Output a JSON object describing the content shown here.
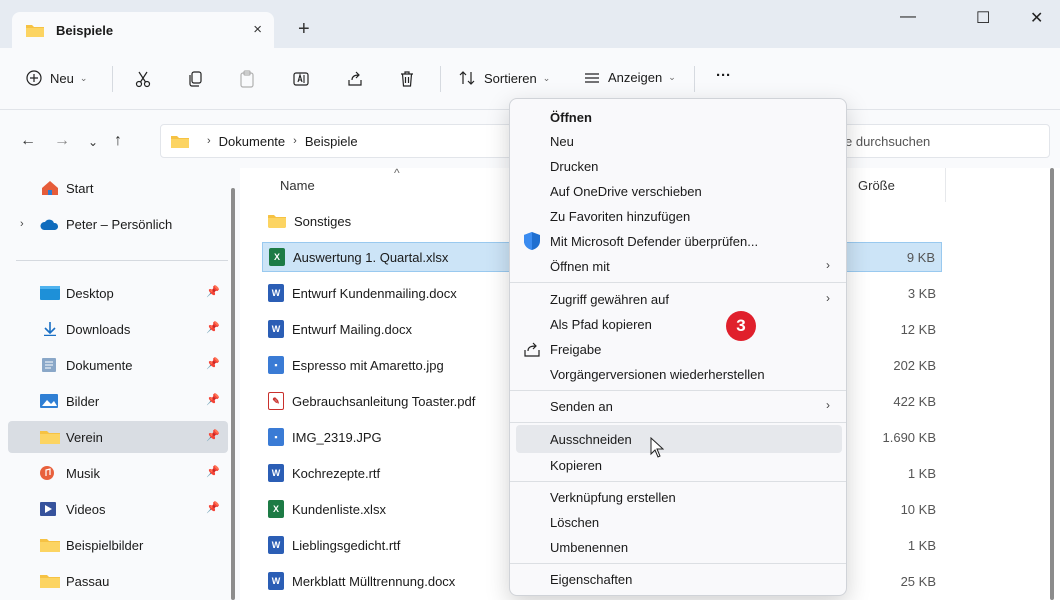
{
  "window": {
    "tab_title": "Beispiele",
    "tab_close": "×",
    "new_tab": "+",
    "minimize": "—",
    "maximize": "☐",
    "close": "✕"
  },
  "toolbar": {
    "new_label": "Neu",
    "sort_label": "Sortieren",
    "view_label": "Anzeigen",
    "more_label": "···"
  },
  "address": {
    "path": [
      "Dokumente",
      "Beispiele"
    ],
    "search_placeholder": "e durchsuchen"
  },
  "sidebar": {
    "top_items": [
      {
        "label": "Start",
        "icon": "home-icon"
      },
      {
        "label": "Peter – Persönlich",
        "icon": "onedrive-cloud-icon"
      }
    ],
    "items": [
      {
        "label": "Desktop",
        "icon": "desktop-folder-icon",
        "pinned": true
      },
      {
        "label": "Downloads",
        "icon": "download-icon",
        "pinned": true
      },
      {
        "label": "Dokumente",
        "icon": "documents-folder-icon",
        "pinned": true
      },
      {
        "label": "Bilder",
        "icon": "pictures-folder-icon",
        "pinned": true
      },
      {
        "label": "Verein",
        "icon": "folder-icon",
        "pinned": true,
        "selected": true
      },
      {
        "label": "Musik",
        "icon": "music-icon",
        "pinned": true
      },
      {
        "label": "Videos",
        "icon": "videos-folder-icon",
        "pinned": true
      },
      {
        "label": "Beispielbilder",
        "icon": "folder-icon",
        "pinned": false
      },
      {
        "label": "Passau",
        "icon": "folder-icon",
        "pinned": false
      }
    ]
  },
  "filelist": {
    "columns": {
      "name": "Name",
      "size": "Größe"
    },
    "rows": [
      {
        "name": "Sonstiges",
        "type": "folder",
        "size": ""
      },
      {
        "name": "Auswertung 1. Quartal.xlsx",
        "type": "xlsx",
        "size": "9 KB",
        "selected": true
      },
      {
        "name": "Entwurf Kundenmailing.docx",
        "type": "docx",
        "size": "3 KB"
      },
      {
        "name": "Entwurf Mailing.docx",
        "type": "docx",
        "size": "12 KB"
      },
      {
        "name": "Espresso mit Amaretto.jpg",
        "type": "jpg",
        "size": "202 KB"
      },
      {
        "name": "Gebrauchsanleitung Toaster.pdf",
        "type": "pdf",
        "size": "422 KB"
      },
      {
        "name": "IMG_2319.JPG",
        "type": "jpg",
        "size": "1.690 KB"
      },
      {
        "name": "Kochrezepte.rtf",
        "type": "rtf",
        "size": "1 KB"
      },
      {
        "name": "Kundenliste.xlsx",
        "type": "xlsx",
        "size": "10 KB"
      },
      {
        "name": "Lieblingsgedicht.rtf",
        "type": "rtf",
        "size": "1 KB"
      },
      {
        "name": "Merkblatt Mülltrennung.docx",
        "type": "docx",
        "size": "25 KB"
      }
    ]
  },
  "context_menu": {
    "items": [
      {
        "label": "Öffnen",
        "bold": true
      },
      {
        "label": "Neu"
      },
      {
        "label": "Drucken"
      },
      {
        "label": "Auf OneDrive verschieben"
      },
      {
        "label": "Zu Favoriten hinzufügen"
      },
      {
        "label": "Mit Microsoft Defender überprüfen...",
        "icon": "defender-shield-icon"
      },
      {
        "label": "Öffnen mit",
        "submenu": true
      },
      {
        "label": "Zugriff gewähren auf",
        "submenu": true
      },
      {
        "label": "Als Pfad kopieren"
      },
      {
        "label": "Freigabe",
        "icon": "share-icon"
      },
      {
        "label": "Vorgängerversionen wiederherstellen"
      },
      {
        "label": "Senden an",
        "submenu": true
      },
      {
        "label": "Ausschneiden",
        "hover": true
      },
      {
        "label": "Kopieren"
      },
      {
        "label": "Verknüpfung erstellen"
      },
      {
        "label": "Löschen"
      },
      {
        "label": "Umbenennen"
      },
      {
        "label": "Eigenschaften"
      }
    ],
    "arrow": "›",
    "step_badge": "3"
  },
  "colors": {
    "accent": "#0067c0",
    "selection": "#cce4f7",
    "folder": "#f6c243",
    "badge": "#e0202c"
  }
}
